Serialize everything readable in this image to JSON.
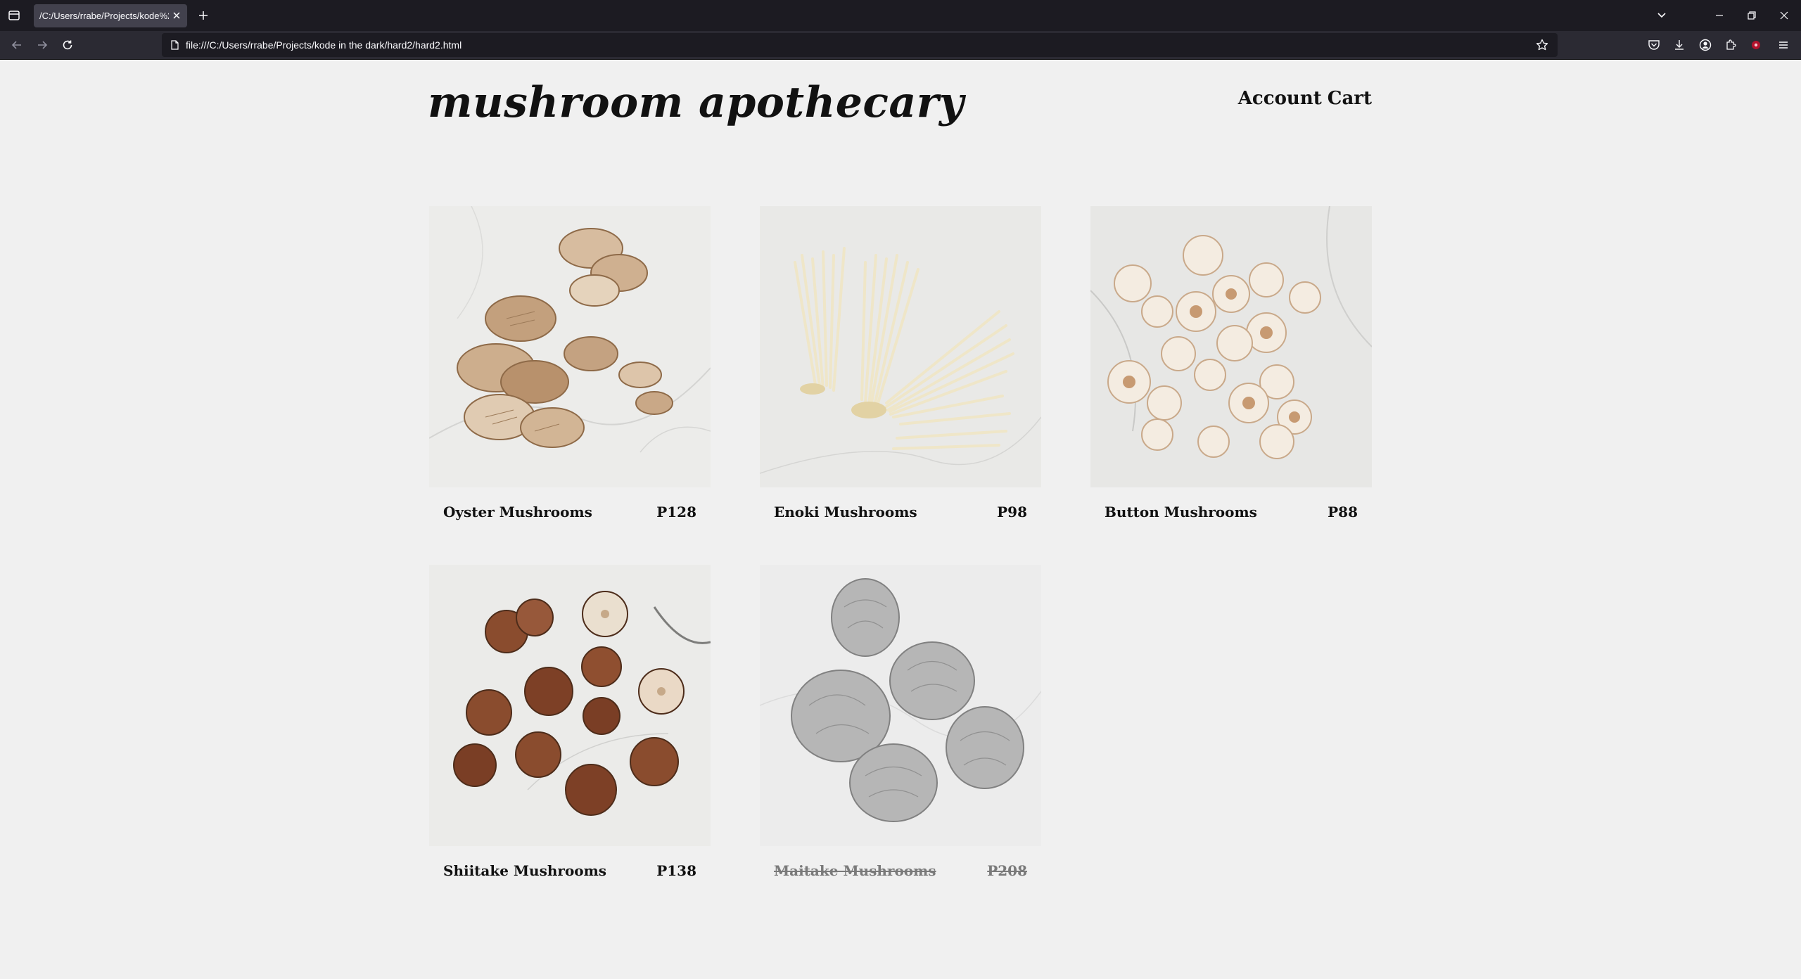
{
  "browser": {
    "tab_title": "/C:/Users/rrabe/Projects/kode%20in",
    "url": "file:///C:/Users/rrabe/Projects/kode in the dark/hard2/hard2.html"
  },
  "site": {
    "title": "mushroom apothecary",
    "nav": {
      "account": "Account",
      "cart": "Cart"
    }
  },
  "products": [
    {
      "name": "Oyster Mushrooms",
      "price": "P128",
      "available": true
    },
    {
      "name": "Enoki Mushrooms",
      "price": "P98",
      "available": true
    },
    {
      "name": "Button Mushrooms",
      "price": "P88",
      "available": true
    },
    {
      "name": "Shiitake Mushrooms",
      "price": "P138",
      "available": true
    },
    {
      "name": "Maitake Mushrooms",
      "price": "P208",
      "available": false
    }
  ]
}
